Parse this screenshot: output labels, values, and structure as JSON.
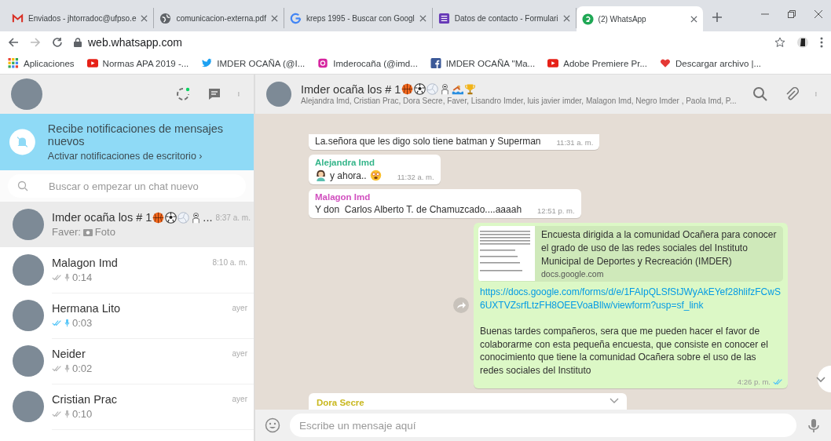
{
  "browser": {
    "tabs": [
      {
        "title": "Enviados - jhtorradoc@ufpso.e",
        "selected": false
      },
      {
        "title": "comunicacion-externa.pdf",
        "selected": false
      },
      {
        "title": "kreps 1995 - Buscar con Googl",
        "selected": false
      },
      {
        "title": "Datos de contacto - Formulari",
        "selected": false
      },
      {
        "title": "(2) WhatsApp",
        "selected": true
      }
    ],
    "address": "web.whatsapp.com",
    "bookmarks": [
      {
        "label": "Aplicaciones"
      },
      {
        "label": "Normas APA 2019 -..."
      },
      {
        "label": "IMDER OCAÑA (@I..."
      },
      {
        "label": "Imderocaña (@imd..."
      },
      {
        "label": "IMDER OCAÑA \"Ma..."
      },
      {
        "label": "Adobe Premiere Pr..."
      },
      {
        "label": "Descargar archivo |..."
      }
    ]
  },
  "sidebar": {
    "notification": {
      "title": "Recibe notificaciones de mensajes nuevos",
      "link": "Activar notificaciones de escritorio ›"
    },
    "search": {
      "placeholder": "Buscar o empezar un chat nuevo"
    },
    "chats": [
      {
        "name": "Imder ocaña los # 1",
        "more": "...",
        "time": "8:37 a. m.",
        "kind": "photo",
        "sender": "Faver:",
        "preview": "Foto",
        "selected": true
      },
      {
        "name": "Malagon Imd",
        "time": "8:10 a. m.",
        "kind": "voice",
        "read": false,
        "preview": "0:14",
        "selected": false
      },
      {
        "name": "Hermana Lito",
        "time": "ayer",
        "kind": "voice",
        "read": true,
        "preview": "0:03",
        "selected": false
      },
      {
        "name": "Neider",
        "time": "ayer",
        "kind": "voice",
        "read": false,
        "preview": "0:02",
        "selected": false
      },
      {
        "name": "Cristian Prac",
        "time": "ayer",
        "kind": "voice",
        "read": false,
        "preview": "0:10",
        "selected": false
      }
    ]
  },
  "chat": {
    "title": "Imder ocaña los # 1",
    "members": "Alejandra Imd, Cristian Prac, Dora Secre, Faver, Lisandro Imder, luis javier imder, Malagon Imd, Negro Imder , Paola Imd, P...",
    "messages": [
      {
        "kind": "text",
        "text": "La.señora que les digo solo tiene batman y Superman",
        "time": "11:31 a. m."
      },
      {
        "kind": "emoji_text",
        "sender": "Alejandra Imd",
        "color": "#35b58a",
        "text": "y ahora..",
        "time": "11:32 a. m."
      },
      {
        "kind": "text",
        "sender": "Malagon Imd",
        "color": "#d14fbf",
        "text": "Y don  Carlos Alberto T. de Chamuzcado....aaaah",
        "time": "12:51 p. m."
      },
      {
        "kind": "link",
        "preview_title": "Encuesta dirigida a la comunidad Ocañera para conocer el grado de uso de las redes sociales del Instituto Municipal de Deportes y Recreación (IMDER)",
        "domain": "docs.google.com",
        "url": "https://docs.google.com/forms/d/e/1FAIpQLSfStJWyAkEYef28hlifzFCwS6UXTVZsrfLtzFH8OEEVoaBllw/viewform?usp=sf_link",
        "text": "Buenas tardes compañeros, sera que me pueden hacer el favor de colaborarme con esta pequeña encuesta, que consiste en conocer el conocimiento que tiene la comunidad Ocañera sobre el uso de las redes sociales del Instituto",
        "time": "4:26 p. m.",
        "read": true
      },
      {
        "kind": "partial",
        "sender": "Dora Secre",
        "color": "#c9b81f"
      }
    ],
    "composer": {
      "placeholder": "Escribe un mensaje aquí"
    }
  }
}
